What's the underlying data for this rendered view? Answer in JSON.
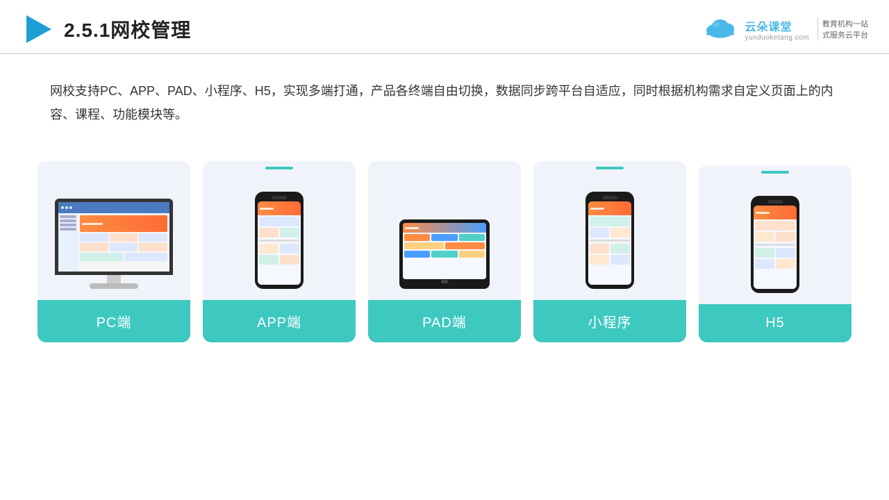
{
  "header": {
    "title": "2.5.1网校管理",
    "logo_name": "云朵课堂",
    "logo_sub": "yunduoketang.com",
    "logo_slogan_line1": "教育机构一站",
    "logo_slogan_line2": "式服务云平台"
  },
  "description": {
    "text": "网校支持PC、APP、PAD、小程序、H5，实现多端打通，产品各终端自由切换，数据同步跨平台自适应，同时根据机构需求自定义页面上的内容、课程、功能模块等。"
  },
  "cards": [
    {
      "id": "pc",
      "label": "PC端",
      "type": "pc"
    },
    {
      "id": "app",
      "label": "APP端",
      "type": "phone"
    },
    {
      "id": "pad",
      "label": "PAD端",
      "type": "tablet"
    },
    {
      "id": "miniapp",
      "label": "小程序",
      "type": "phone"
    },
    {
      "id": "h5",
      "label": "H5",
      "type": "phone"
    }
  ]
}
